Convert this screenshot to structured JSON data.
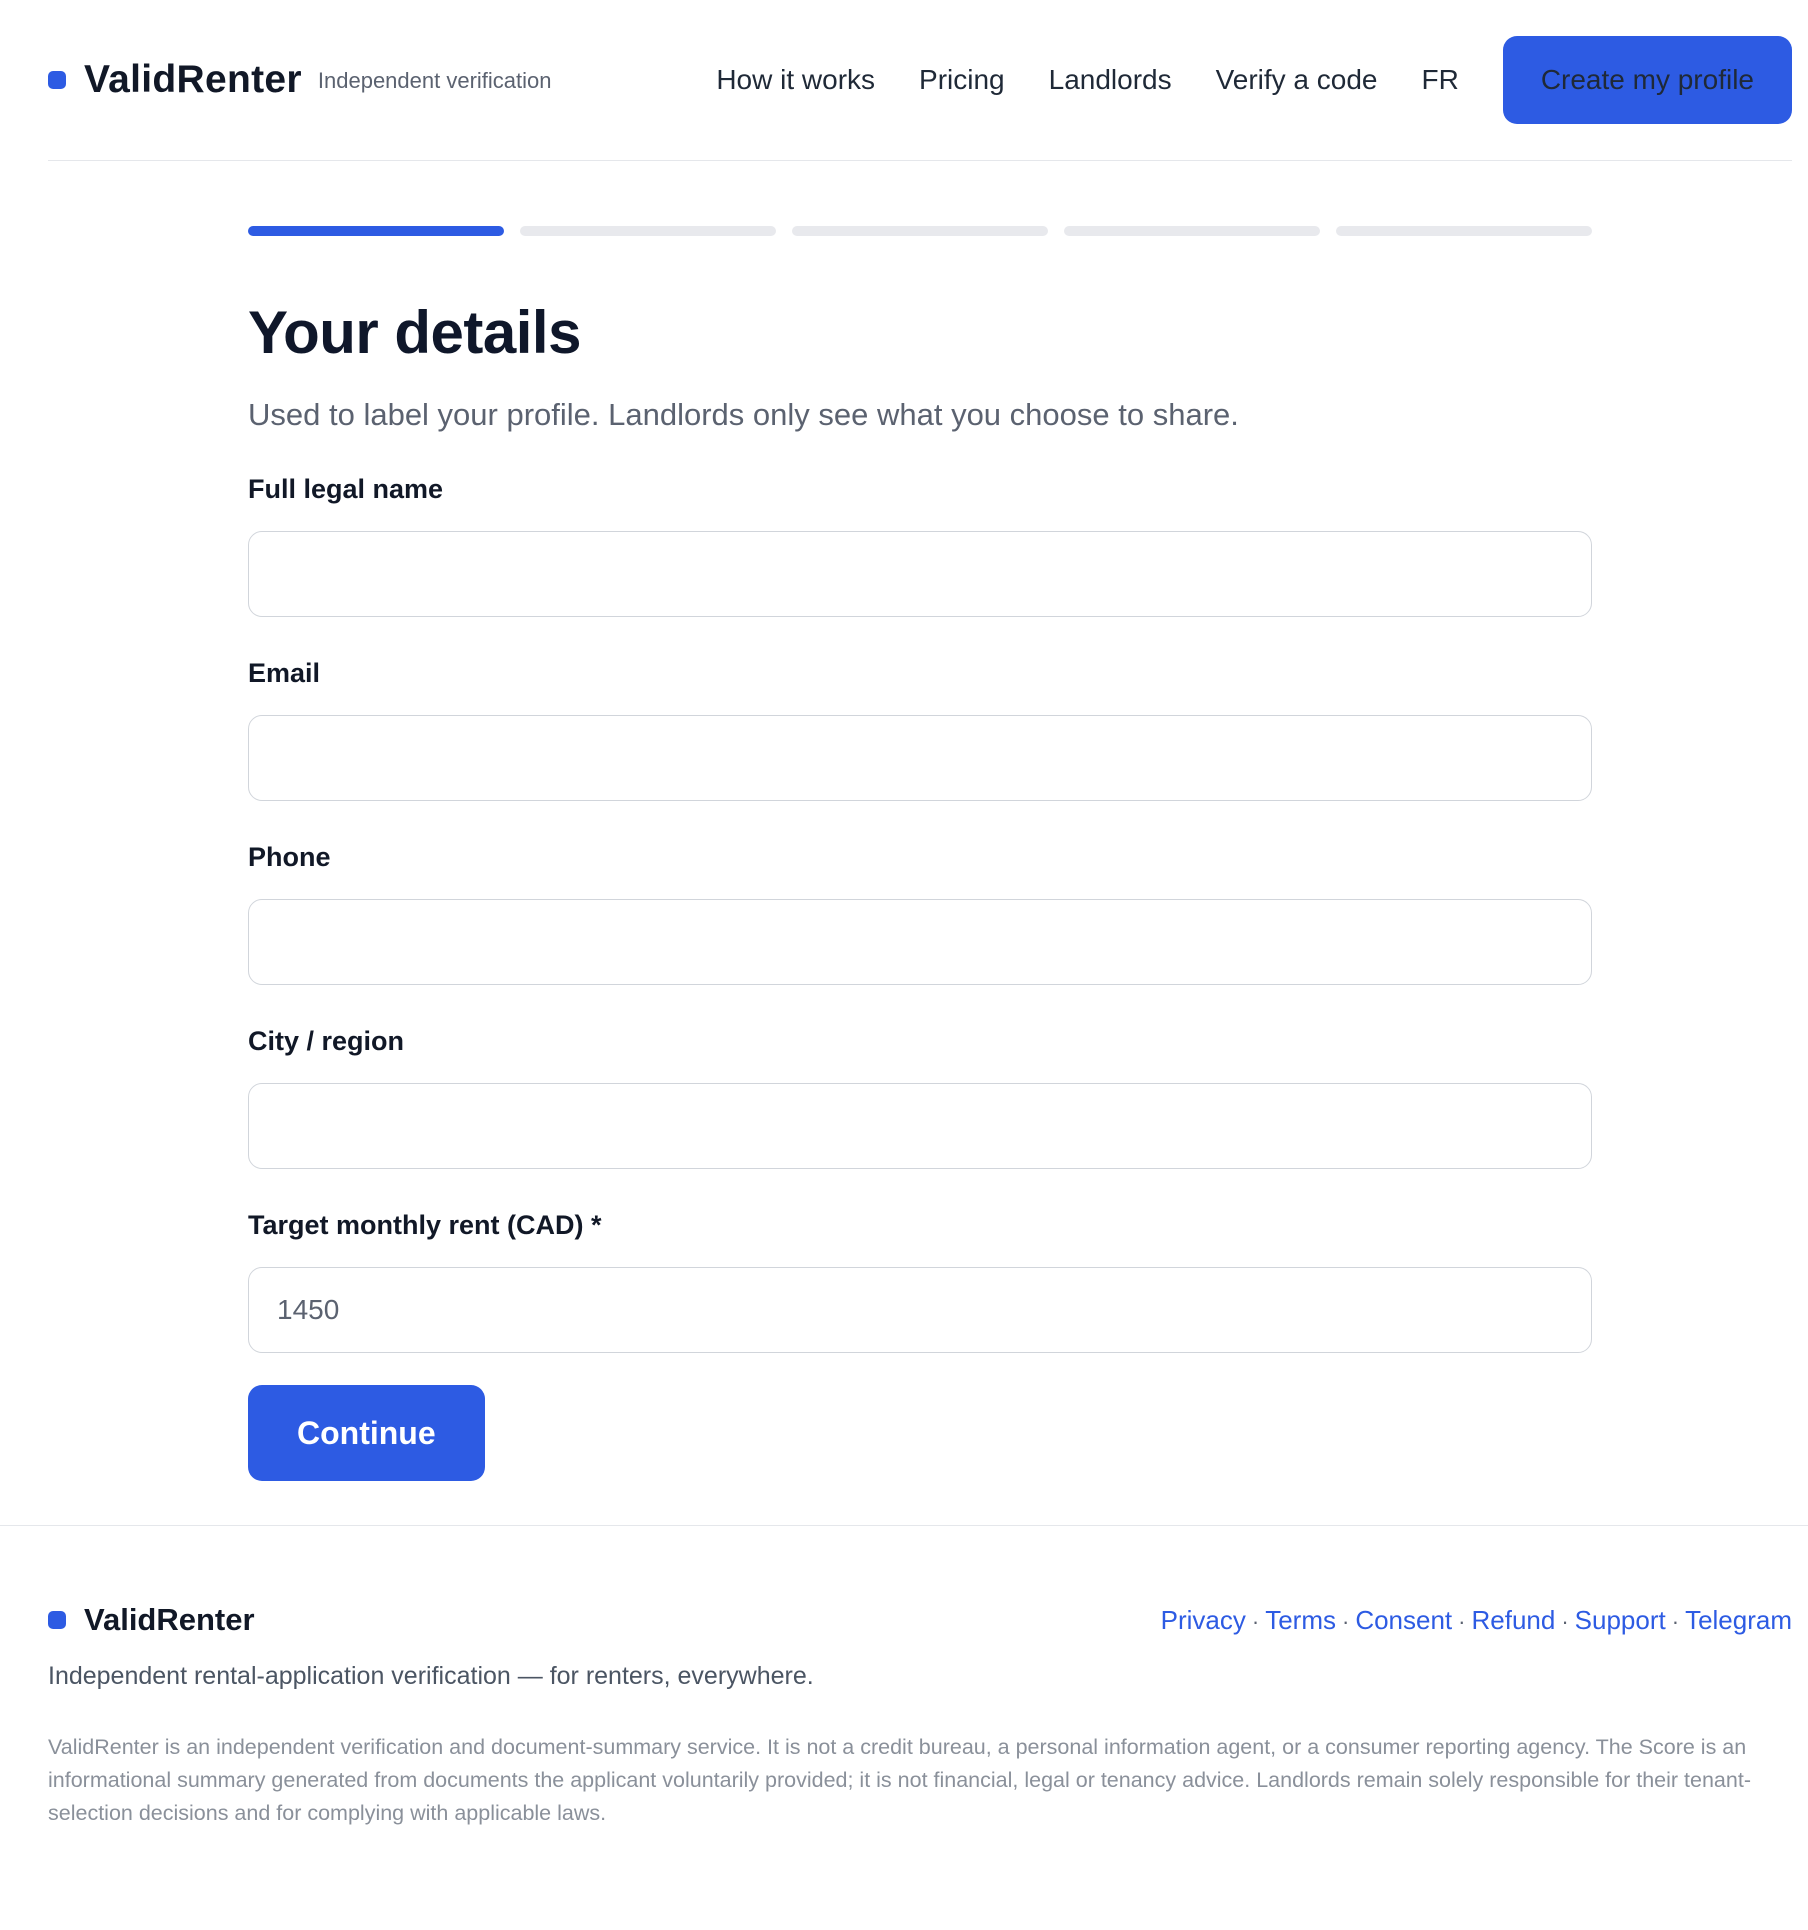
{
  "header": {
    "brand_name": "ValidRenter",
    "brand_tag": "Independent verification",
    "nav": [
      "How it works",
      "Pricing",
      "Landlords",
      "Verify a code",
      "FR"
    ],
    "cta_label": "Create my profile"
  },
  "progress": {
    "total_steps": 5,
    "current_step": 1
  },
  "form": {
    "title": "Your details",
    "subtitle": "Used to label your profile. Landlords only see what you choose to share.",
    "fields": [
      {
        "label": "Full legal name",
        "value": "",
        "placeholder": ""
      },
      {
        "label": "Email",
        "value": "",
        "placeholder": ""
      },
      {
        "label": "Phone",
        "value": "",
        "placeholder": ""
      },
      {
        "label": "City / region",
        "value": "",
        "placeholder": ""
      },
      {
        "label": "Target monthly rent (CAD) *",
        "value": "",
        "placeholder": "1450"
      }
    ],
    "continue_label": "Continue"
  },
  "footer": {
    "brand_name": "ValidRenter",
    "links": [
      "Privacy",
      "Terms",
      "Consent",
      "Refund",
      "Support",
      "Telegram"
    ],
    "separator": "·",
    "tagline": "Independent rental-application verification — for renters, everywhere.",
    "disclaimer": "ValidRenter is an independent verification and document-summary service. It is not a credit bureau, a personal information agent, or a consumer reporting agency. The Score is an informational summary generated from documents the applicant voluntarily provided; it is not financial, legal or tenancy advice. Landlords remain solely responsible for their tenant-selection decisions and for complying with applicable laws."
  },
  "colors": {
    "accent": "#2d5be3",
    "text": "#111827",
    "muted": "#5b6270",
    "border": "#d1d5db"
  }
}
